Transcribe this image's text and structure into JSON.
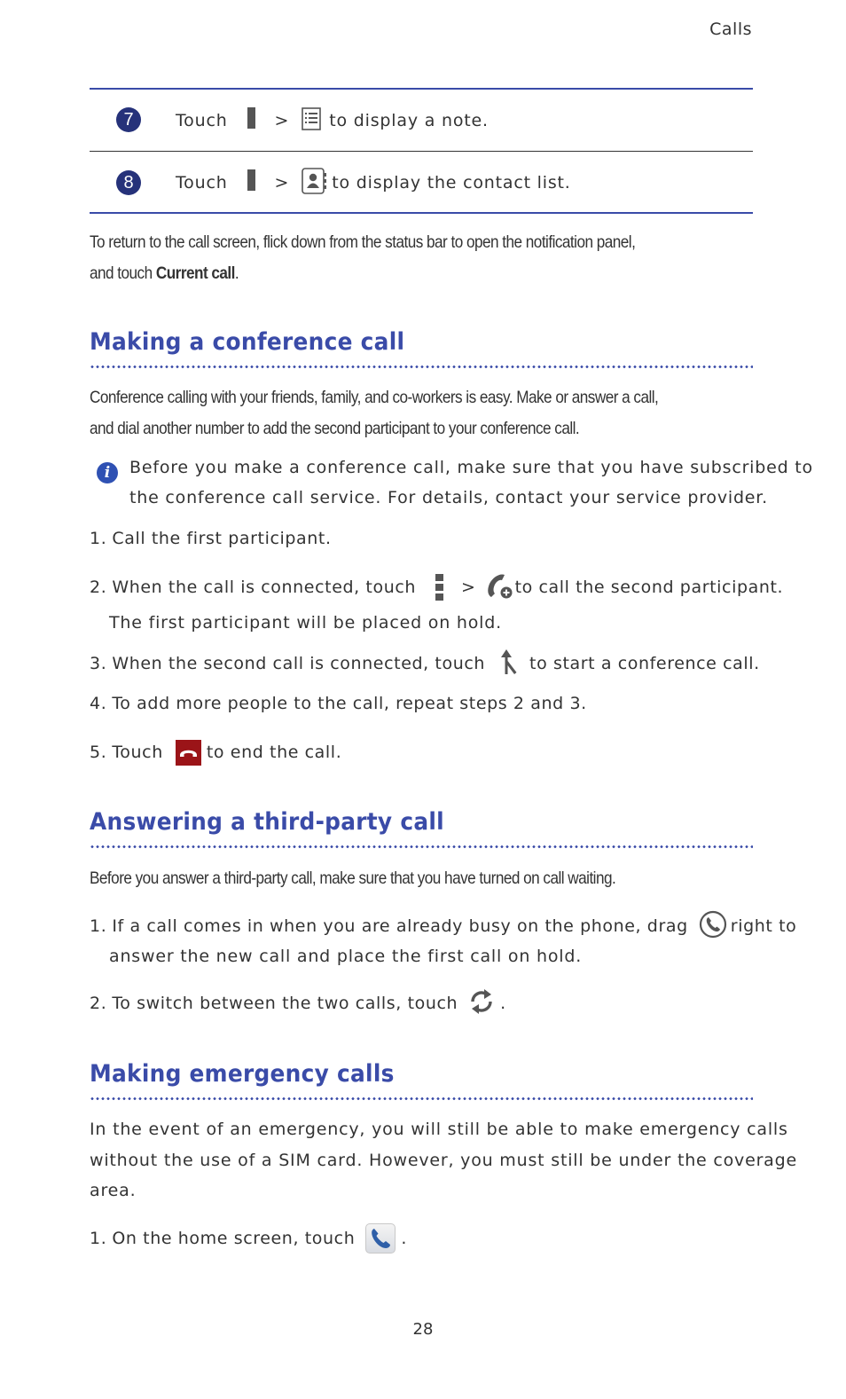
{
  "header": {
    "section": "Calls"
  },
  "callout_table": {
    "rows": [
      {
        "number": "7",
        "touch": "Touch",
        "sep": ">",
        "text": "to display a note.",
        "icons": [
          "menu-icon",
          "note-icon"
        ]
      },
      {
        "number": "8",
        "touch": "Touch",
        "sep": ">",
        "text": "to display the contact list.",
        "icons": [
          "menu-icon",
          "contacts-icon"
        ]
      }
    ]
  },
  "return_note": {
    "line1": "To return to the call screen, flick down from the status bar to open the notification panel,",
    "line2_prefix": "and touch ",
    "line2_bold": "Current call",
    "line2_suffix": "."
  },
  "sections": {
    "conference": {
      "title": "Making a conference call",
      "intro_line1": "Conference calling with your friends, family, and co-workers is easy. Make or answer a call,",
      "intro_line2": "and dial another number to add the second participant to your conference call.",
      "note_line1": "Before you make a conference call, make sure that you have subscribed to",
      "note_line2": "the conference call service. For details, contact your service provider.",
      "steps": [
        {
          "num": "1.",
          "text": "Call the first participant."
        },
        {
          "num": "2.",
          "text_before": "When the call is connected, touch",
          "sep": ">",
          "text_after": "to call the second participant.",
          "continuation": "The first participant will be placed on hold."
        },
        {
          "num": "3.",
          "text_before": "When the second call is connected, touch",
          "text_after": "to start a conference call."
        },
        {
          "num": "4.",
          "text": "To add more people to the call, repeat steps 2 and 3."
        },
        {
          "num": "5.",
          "text_before": "Touch",
          "text_after": "to end the call."
        }
      ]
    },
    "third_party": {
      "title": "Answering a third-party call",
      "intro": "Before you answer a third-party call, make sure that you have turned on call waiting.",
      "steps": [
        {
          "num": "1.",
          "text_before": "If a call comes in when you are already busy on the phone, drag",
          "text_after": "right to",
          "continuation": "answer the new call and place the first call on hold."
        },
        {
          "num": "2.",
          "text_before": "To switch between the two calls, touch",
          "text_after": "."
        }
      ]
    },
    "emergency": {
      "title": "Making emergency calls",
      "intro_line1": "In the event of an emergency, you will still be able to make emergency calls",
      "intro_line2": "without the use of a SIM card. However, you must still be under the coverage",
      "intro_line3": "area.",
      "steps": [
        {
          "num": "1.",
          "text_before": "On the home screen, touch",
          "text_after": "."
        }
      ]
    }
  },
  "colors": {
    "heading_blue": "#3a4ba8",
    "callout_navy": "#26327a",
    "end_call_red": "#9b1418",
    "info_blue": "#2f51b3"
  },
  "footer": {
    "page_number": "28"
  }
}
